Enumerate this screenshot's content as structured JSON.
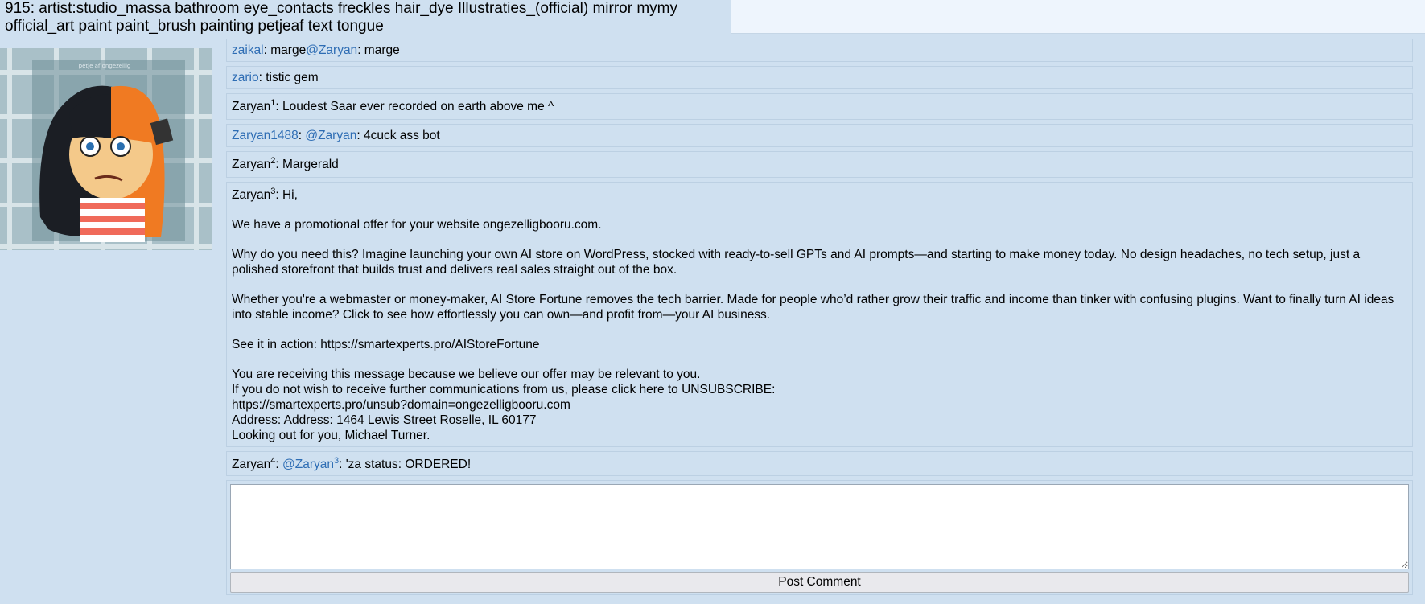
{
  "post": {
    "title": "915: artist:studio_massa bathroom eye_contacts freckles hair_dye Illustraties_(official) mirror mymy official_art paint paint_brush painting petjeaf text tongue",
    "thumbnail_caption": "petje af ongezellig"
  },
  "comments": [
    {
      "author": "zaikal",
      "text_before": ": marge",
      "mention": "@Zaryan",
      "text_after": ": marge"
    },
    {
      "author": "zario",
      "text": ": tistic gem"
    },
    {
      "author": "Zaryan",
      "sup": "1",
      "text": ": Loudest Saar ever recorded on earth above me ^"
    },
    {
      "author": "Zaryan1488",
      "mention": "@Zaryan",
      "text": ": 4cuck ass bot"
    },
    {
      "author": "Zaryan",
      "sup": "2",
      "text": ": Margerald"
    },
    {
      "author": "Zaryan",
      "sup": "3",
      "greeting": ": Hi,",
      "p1": "We have a promotional offer for your website ongezelligbooru.com.",
      "p2": "Why do you need this? Imagine launching your own AI store on WordPress, stocked with ready-to-sell GPTs and AI prompts—and starting to make money today. No design headaches, no tech setup, just a polished storefront that builds trust and delivers real sales straight out of the box.",
      "p3": "Whether you're a webmaster or money-maker, AI Store Fortune removes the tech barrier. Made for people who’d rather grow their traffic and income than tinker with confusing plugins. Want to finally turn AI ideas into stable income? Click to see how effortlessly you can own—and profit from—your AI business.",
      "p4": "See it in action: https://smartexperts.pro/AIStoreFortune",
      "p5_l1": "You are receiving this message because we believe our offer may be relevant to you.",
      "p5_l2": "If you do not wish to receive further communications from us, please click here to UNSUBSCRIBE:",
      "p5_l3": "https://smartexperts.pro/unsub?domain=ongezelligbooru.com",
      "p5_l4": "Address: Address: 1464 Lewis Street Roselle, IL 60177",
      "p5_l5": "Looking out for you, Michael Turner."
    },
    {
      "author": "Zaryan",
      "sup": "4",
      "mention": "@Zaryan",
      "mention_sup": "3",
      "text": ": 'za status: ORDERED!"
    }
  ],
  "composer": {
    "textarea_value": "",
    "submit_label": "Post Comment"
  },
  "colors": {
    "background": "#cfe0f0",
    "link": "#2e6db4",
    "top_right_panel": "#eef5fd"
  }
}
